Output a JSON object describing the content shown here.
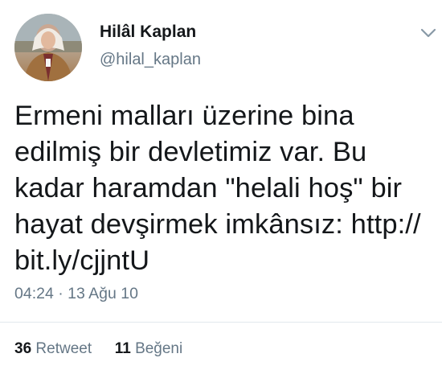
{
  "author": {
    "display_name": "Hilâl Kaplan",
    "handle": "@hilal_kaplan",
    "avatar_icon": "profile-photo"
  },
  "tweet": {
    "lines": [
      "Ermeni malları üzerine bina",
      "edilmiş bir devletimiz var. Bu",
      "kadar haramdan \"helali hoş\" bir",
      "hayat devşirmek imkânsız: http://",
      "bit.ly/cjjntU"
    ],
    "timestamp": "04:24 · 13 Ağu 10"
  },
  "stats": {
    "retweets_count": "36",
    "retweets_label": "Retweet",
    "likes_count": "11",
    "likes_label": "Beğeni"
  },
  "menu": {
    "icon": "chevron-down-icon"
  },
  "colors": {
    "text": "#14171a",
    "muted": "#657786",
    "divider": "#e1e8ed"
  }
}
